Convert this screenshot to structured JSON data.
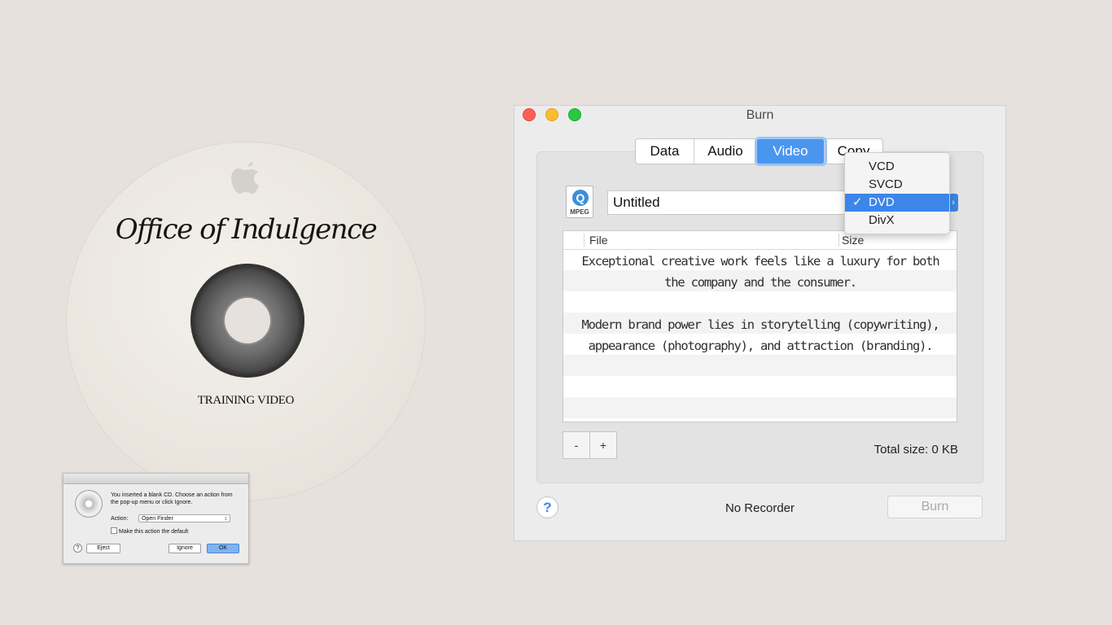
{
  "disc": {
    "title": "Office of Indulgence",
    "subtitle": "TRAINING VIDEO",
    "logo_icon": "apple-logo-icon"
  },
  "cd_dialog": {
    "message": "You inserted a blank CD. Choose an action from the pop-up menu or click Ignore.",
    "action_label": "Action:",
    "action_value": "Open Finder",
    "default_checkbox_label": "Make this action the default",
    "help": "?",
    "eject": "Eject",
    "ignore": "Ignore",
    "ok": "OK"
  },
  "window": {
    "title": "Burn",
    "tabs": [
      "Data",
      "Audio",
      "Video",
      "Copy"
    ],
    "active_tab": "Video",
    "name_value": "Untitled",
    "file_icon_label": "MPEG",
    "columns": {
      "file": "File",
      "size": "Size"
    },
    "body_lines": [
      "Exceptional creative work feels like a luxury for both the company and the consumer.",
      "Modern brand power lies in storytelling (copywriting), appearance (photography), and attraction (branding)."
    ],
    "minus": "-",
    "plus": "+",
    "total_size": "Total size: 0 KB",
    "help": "?",
    "status": "No Recorder",
    "burn_button": "Burn",
    "format_menu": {
      "options": [
        "VCD",
        "SVCD",
        "DVD",
        "DivX"
      ],
      "selected": "DVD",
      "check": "✓"
    },
    "colors": {
      "accent": "#3b86e8",
      "close": "#fc5f57",
      "minimize": "#fdbc2e",
      "zoom": "#28c840"
    }
  }
}
